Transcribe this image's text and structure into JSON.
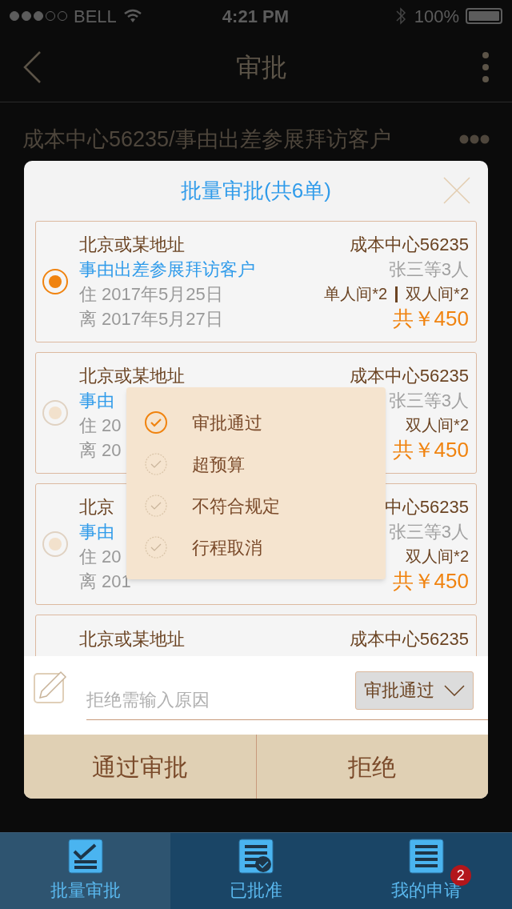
{
  "status_bar": {
    "carrier": "BELL",
    "time": "4:21 PM",
    "battery": "100%"
  },
  "nav": {
    "title": "审批"
  },
  "background_item": {
    "text": "成本中心56235/事由出差参展拜访客户"
  },
  "modal": {
    "title": "批量审批(共6单)",
    "orders": [
      {
        "selected": true,
        "name": "北京或某地址",
        "reason": "事由出差参展拜访客户",
        "check_in": "住 2017年5月25日",
        "check_out": "离 2017年5月27日",
        "cost_center": "成本中心56235",
        "people": "张三等3人",
        "rooms": [
          "单人间*2",
          "双人间*2"
        ],
        "total": "共￥450"
      },
      {
        "selected": false,
        "name": "北京或某地址",
        "reason": "事由",
        "check_in": "住 20",
        "check_out": "离 20",
        "cost_center": "成本中心56235",
        "people": "张三等3人",
        "rooms": [
          "双人间*2"
        ],
        "total": "共￥450"
      },
      {
        "selected": false,
        "name": "北京",
        "reason": "事由",
        "check_in": "住 20",
        "check_out": "离 201",
        "cost_center": "中心56235",
        "people": "张三等3人",
        "rooms": [
          "双人间*2"
        ],
        "total": "共￥450"
      },
      {
        "kind": "cut",
        "name": "北京或某地址",
        "cost_center": "成本中心56235"
      }
    ],
    "reason_field": {
      "placeholder": "拒绝需输入原因"
    },
    "result_select": {
      "value": "审批通过"
    },
    "buttons": [
      "通过审批",
      "拒绝"
    ],
    "menu": [
      {
        "label": "审批通过",
        "selected": true
      },
      {
        "label": "超预算",
        "selected": false
      },
      {
        "label": "不符合规定",
        "selected": false
      },
      {
        "label": "行程取消",
        "selected": false
      }
    ]
  },
  "tab_bar": [
    {
      "label": "批量审批",
      "selected": true,
      "kind": "batch"
    },
    {
      "label": "已批准",
      "selected": false,
      "kind": "approved"
    },
    {
      "label": "我的申请",
      "selected": false,
      "kind": "mine",
      "badge": "2"
    }
  ]
}
